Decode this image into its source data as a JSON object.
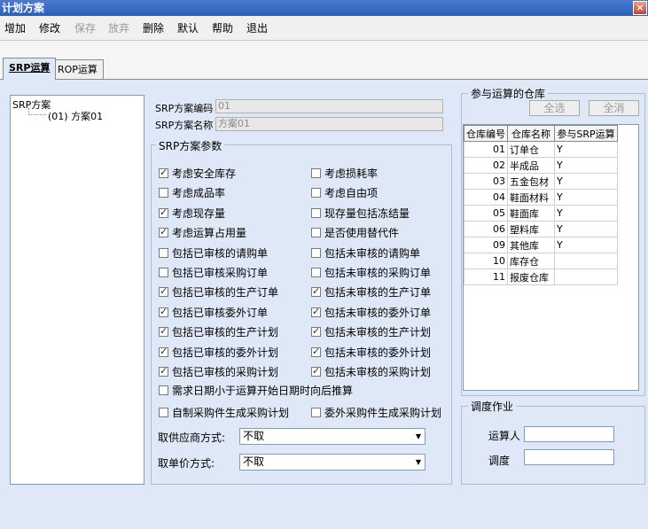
{
  "window": {
    "title": "计划方案",
    "close": "×"
  },
  "toolbar": {
    "add": "增加",
    "edit": "修改",
    "save": "保存",
    "discard": "放弃",
    "delete": "删除",
    "default": "默认",
    "help": "帮助",
    "exit": "退出"
  },
  "tabs": {
    "srp": "SRP运算",
    "rop": "ROP运算"
  },
  "tree": {
    "root": "SRP方案",
    "child": "(01) 方案01"
  },
  "plan": {
    "code_label": "SRP方案编码",
    "code_value": "01",
    "name_label": "SRP方案名称",
    "name_value": "方案01"
  },
  "params": {
    "legend": "SRP方案参数",
    "left": [
      {
        "label": "考虑安全库存",
        "checked": true
      },
      {
        "label": "考虑成品率",
        "checked": false
      },
      {
        "label": "考虑现存量",
        "checked": true
      },
      {
        "label": "考虑运算占用量",
        "checked": true
      },
      {
        "label": "包括已审核的请购单",
        "checked": false
      },
      {
        "label": "包括已审核采购订单",
        "checked": false
      },
      {
        "label": "包括已审核的生产订单",
        "checked": true
      },
      {
        "label": "包括已审核委外订单",
        "checked": true
      },
      {
        "label": "包括已审核的生产计划",
        "checked": true
      },
      {
        "label": "包括已审核的委外计划",
        "checked": true
      },
      {
        "label": "包括已审核的采购计划",
        "checked": true
      }
    ],
    "right": [
      {
        "label": "考虑损耗率",
        "checked": false
      },
      {
        "label": "考虑自由项",
        "checked": false
      },
      {
        "label": "现存量包括冻结量",
        "checked": false
      },
      {
        "label": "是否使用替代件",
        "checked": false
      },
      {
        "label": "包括未审核的请购单",
        "checked": false
      },
      {
        "label": "包括未审核的采购订单",
        "checked": false
      },
      {
        "label": "包括未审核的生产订单",
        "checked": true
      },
      {
        "label": "包括未审核的委外订单",
        "checked": true
      },
      {
        "label": "包括未审核的生产计划",
        "checked": true
      },
      {
        "label": "包括未审核的委外计划",
        "checked": true
      },
      {
        "label": "包括未审核的采购计划",
        "checked": true
      }
    ],
    "demand_date": {
      "label": "需求日期小于运算开始日期时向后推算",
      "checked": false
    },
    "self_made": {
      "label": "自制采购件生成采购计划",
      "checked": false
    },
    "outsourced": {
      "label": "委外采购件生成采购计划",
      "checked": false
    },
    "supplier_label": "取供应商方式:",
    "supplier_value": "不取",
    "price_label": "取单价方式:",
    "price_value": "不取"
  },
  "warehouse": {
    "legend": "参与运算的仓库",
    "select_all": "全选",
    "clear_all": "全消",
    "headers": [
      "仓库编号",
      "仓库名称",
      "参与SRP运算"
    ],
    "rows": [
      [
        "01",
        "订单仓",
        "Y"
      ],
      [
        "02",
        "半成品",
        "Y"
      ],
      [
        "03",
        "五金包材",
        "Y"
      ],
      [
        "04",
        "鞋面材料",
        "Y"
      ],
      [
        "05",
        "鞋面库",
        "Y"
      ],
      [
        "06",
        "塑料库",
        "Y"
      ],
      [
        "09",
        "其他库",
        "Y"
      ],
      [
        "10",
        "库存仓",
        ""
      ],
      [
        "11",
        "报废仓库",
        ""
      ]
    ]
  },
  "dispatch": {
    "legend": "调度作业",
    "operator_label": "运算人",
    "dispatch_label": "调度"
  }
}
